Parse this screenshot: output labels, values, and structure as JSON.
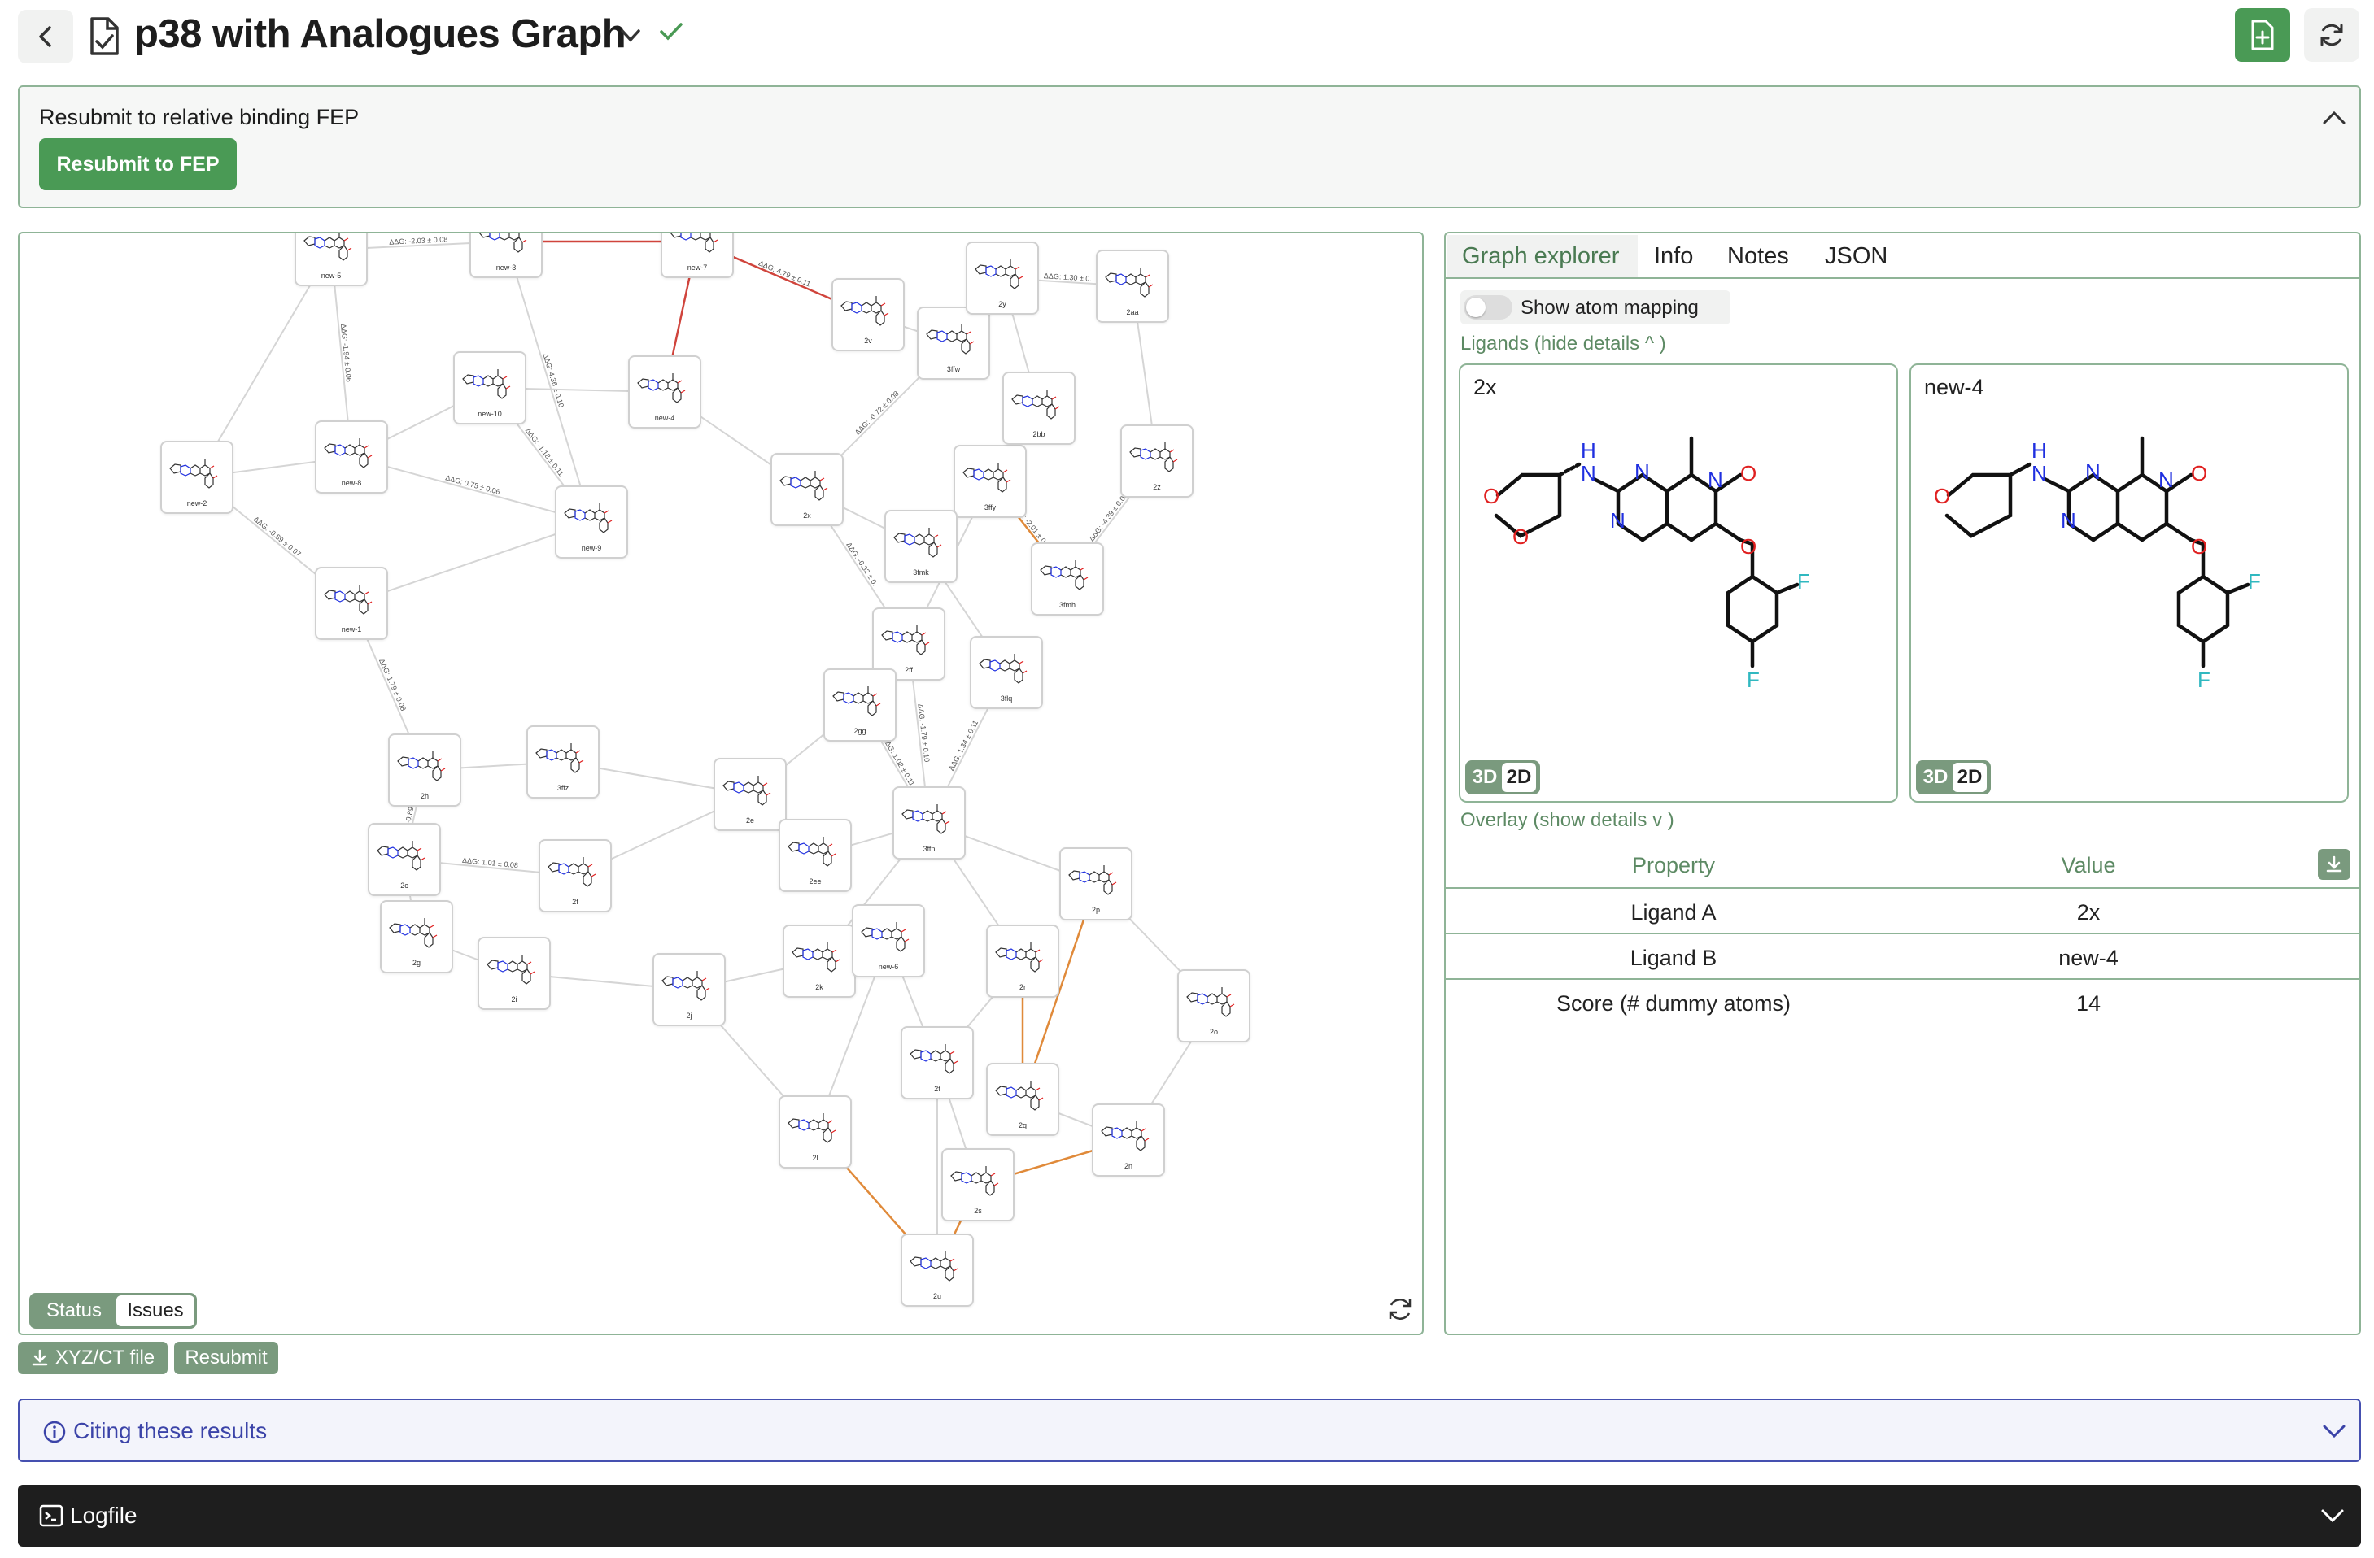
{
  "header": {
    "title": "p38 with Analogues Graph"
  },
  "resubmit_panel": {
    "text": "Resubmit to relative binding FEP",
    "button": "Resubmit to FEP"
  },
  "graph": {
    "nodes": [
      "new-5",
      "new-3",
      "new-7",
      "2v",
      "3ffw",
      "2y",
      "2aa",
      "new-2",
      "new-8",
      "new-10",
      "new-4",
      "2x",
      "3ffy",
      "2bb",
      "2z",
      "new-9",
      "new-1",
      "3fmk",
      "3fmh",
      "2ff",
      "3flq",
      "2gg",
      "2h",
      "3ffz",
      "2e",
      "3ffn",
      "2ee",
      "2c",
      "2f",
      "2g",
      "2i",
      "2j",
      "2k",
      "new-6",
      "2r",
      "2p",
      "2o",
      "2l",
      "2t",
      "2q",
      "2n",
      "2s",
      "2u"
    ],
    "edge_labels": [
      "ΔΔG: -2.03 ± 0.08",
      "ΔΔG: -1.94 ± 0.06",
      "ΔΔG: 4.36 ± 0.10",
      "ΔΔG: 4.79 ± 0.11",
      "ΔΔG: -0.89 ± 0.07",
      "ΔΔG: 0.75 ± 0.06",
      "ΔΔG: -1.18 ± 0.11",
      "ΔΔG: 1.79 ± 0.08",
      "ΔΔG: -0.72 ± 0.08",
      "ΔΔG: -0.32 ± 0.",
      "ΔΔG: 0.12 ± 0.09",
      "ΔΔG: 1.30 ± 0.",
      "ΔΔG: 2.30 ± 0.09",
      "ΔΔG: -2.01 ± 0.07",
      "ΔΔG: -4.39 ± 0.08",
      "ΔΔG: -1.79 ± 0.10",
      "ΔΔG: 1.34 ± 0.11",
      "ΔΔG: 1.02 ± 0.11",
      "ΔΔG: -0.89 ± 0.07",
      "ΔΔG: 1.01 ± 0.08"
    ],
    "status_tabs": [
      "Status",
      "Issues"
    ],
    "active_status_tab": "Issues"
  },
  "graph_actions": {
    "download": "XYZ/CT file",
    "resubmit": "Resubmit"
  },
  "explorer": {
    "tabs": [
      "Graph explorer",
      "Info",
      "Notes",
      "JSON"
    ],
    "active_tab": "Graph explorer",
    "atom_mapping_label": "Show atom mapping",
    "atom_mapping_on": false,
    "ligands_label": "Ligands",
    "ligands_toggle": "(hide details",
    "ligand_a": {
      "name": "2x",
      "mode_3d": "3D",
      "mode_2d": "2D",
      "active_mode": "2D"
    },
    "ligand_b": {
      "name": "new-4",
      "mode_3d": "3D",
      "mode_2d": "2D",
      "active_mode": "2D"
    },
    "overlay_label": "Overlay",
    "overlay_toggle": "(show details",
    "table": {
      "headers": [
        "Property",
        "Value"
      ],
      "rows": [
        {
          "property": "Ligand A",
          "value": "2x"
        },
        {
          "property": "Ligand B",
          "value": "new-4"
        },
        {
          "property": "Score (# dummy atoms)",
          "value": "14"
        }
      ]
    }
  },
  "citing": {
    "label": "Citing these results"
  },
  "logfile": {
    "label": "Logfile"
  },
  "colors": {
    "accent": "#4a9a55",
    "border": "#8fb497",
    "link_blue": "#3b43a8",
    "dark": "#1e1e1e",
    "edge_red": "#d0443c",
    "edge_orange": "#e08a3a"
  }
}
